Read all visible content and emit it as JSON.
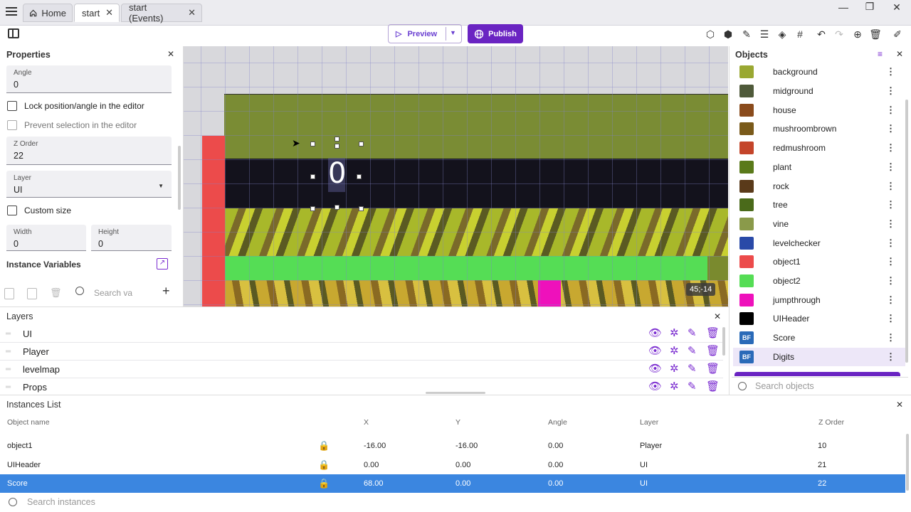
{
  "tabs": [
    {
      "label": "Home",
      "icon": "home-icon"
    },
    {
      "label": "start",
      "active": true
    },
    {
      "label": "start (Events)"
    }
  ],
  "toolbar": {
    "preview_label": "Preview",
    "publish_label": "Publish"
  },
  "properties": {
    "title": "Properties",
    "angle": {
      "label": "Angle",
      "value": "0"
    },
    "lock_label": "Lock position/angle in the editor",
    "prevent_label": "Prevent selection in the editor",
    "zorder": {
      "label": "Z Order",
      "value": "22"
    },
    "layer": {
      "label": "Layer",
      "value": "UI"
    },
    "custom_size_label": "Custom size",
    "width": {
      "label": "Width",
      "value": "0"
    },
    "height": {
      "label": "Height",
      "value": "0"
    },
    "instance_vars_label": "Instance Variables",
    "search_placeholder": "Search va"
  },
  "canvas": {
    "coords": "45;-14",
    "digit_text": "0"
  },
  "objects": {
    "title": "Objects",
    "items": [
      {
        "name": "background",
        "color": "#9aa832"
      },
      {
        "name": "midground",
        "color": "#4f5a3a"
      },
      {
        "name": "house",
        "color": "#8a4b1c"
      },
      {
        "name": "mushroombrown",
        "color": "#7a5a1a"
      },
      {
        "name": "redmushroom",
        "color": "#c4452a"
      },
      {
        "name": "plant",
        "color": "#5a7a1a"
      },
      {
        "name": "rock",
        "color": "#5a3a1a"
      },
      {
        "name": "tree",
        "color": "#4a6a1a"
      },
      {
        "name": "vine",
        "color": "#8a9a4a"
      },
      {
        "name": "levelchecker",
        "color": "#2a4aa8"
      },
      {
        "name": "object1",
        "color": "#ec4b4b"
      },
      {
        "name": "object2",
        "color": "#55dd55"
      },
      {
        "name": "jumpthrough",
        "color": "#ee11bb"
      },
      {
        "name": "UIHeader",
        "color": "#000000"
      },
      {
        "name": "Score",
        "color": "#2a6ab8",
        "label": "BF"
      },
      {
        "name": "Digits",
        "color": "#2a6ab8",
        "label": "BF"
      }
    ],
    "search_placeholder": "Search objects"
  },
  "layers": {
    "title": "Layers",
    "items": [
      "UI",
      "Player",
      "levelmap",
      "Props"
    ]
  },
  "instances": {
    "title": "Instances List",
    "headers": {
      "name": "Object name",
      "x": "X",
      "y": "Y",
      "angle": "Angle",
      "layer": "Layer",
      "z": "Z Order"
    },
    "rows": [
      {
        "name": "object1",
        "x": "-16.00",
        "y": "-16.00",
        "angle": "0.00",
        "layer": "Player",
        "z": "10"
      },
      {
        "name": "UIHeader",
        "x": "0.00",
        "y": "0.00",
        "angle": "0.00",
        "layer": "UI",
        "z": "21"
      },
      {
        "name": "Score",
        "x": "68.00",
        "y": "0.00",
        "angle": "0.00",
        "layer": "UI",
        "z": "22",
        "selected": true
      }
    ],
    "search_placeholder": "Search instances"
  },
  "colors": {
    "accent": "#6a24c2",
    "selection": "#3b86e0"
  }
}
